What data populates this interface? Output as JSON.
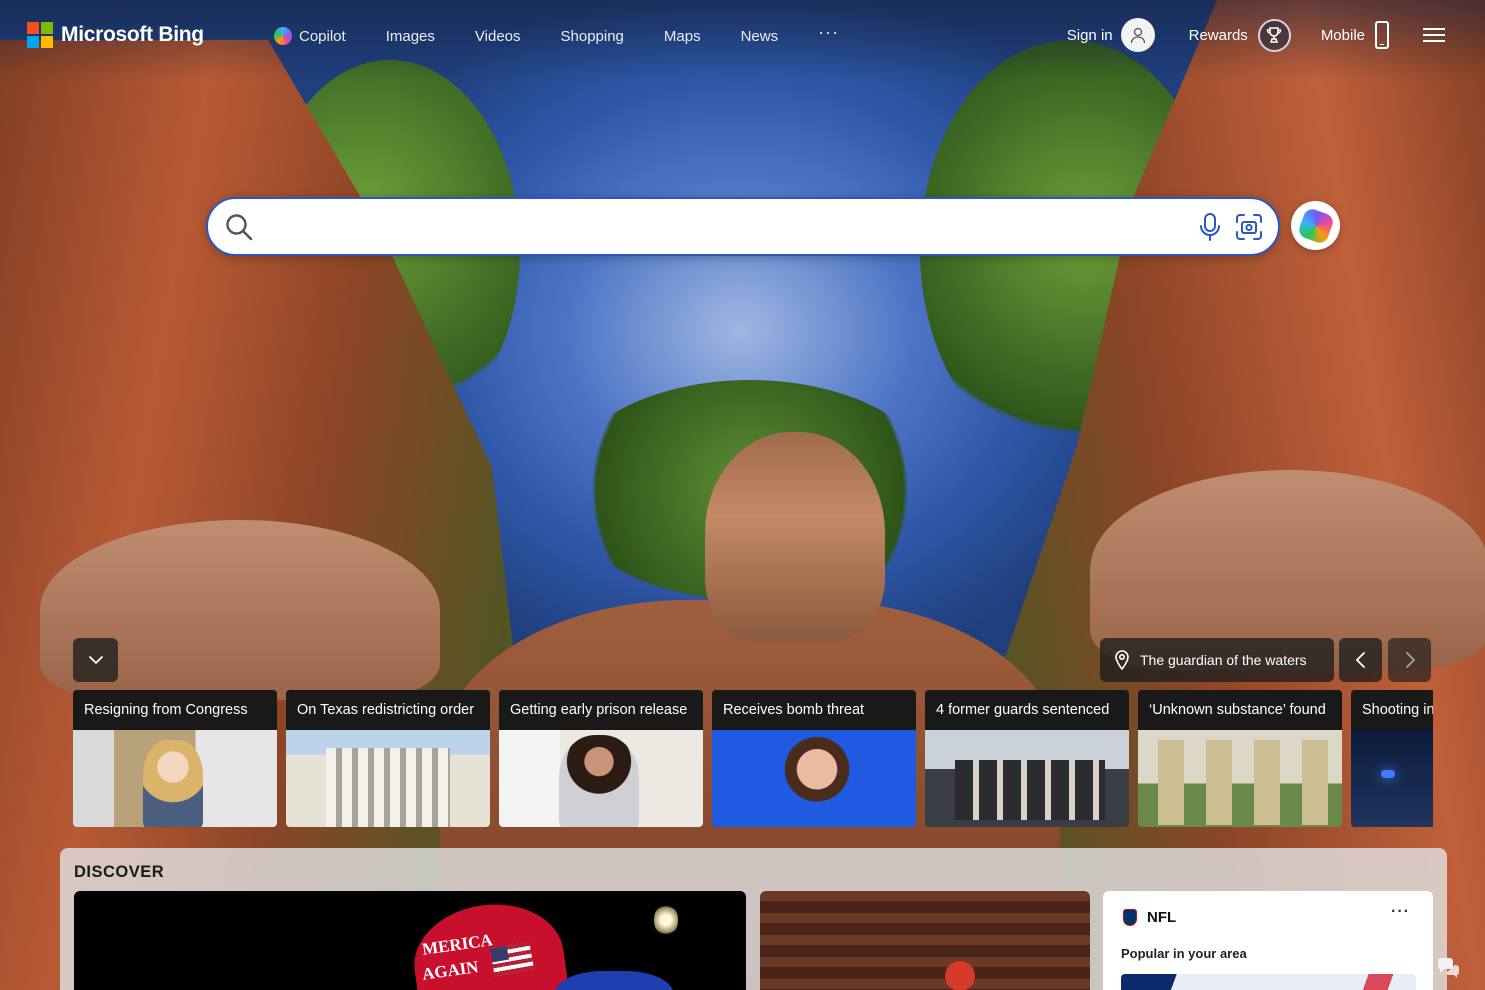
{
  "brand": {
    "name": "Microsoft Bing",
    "logo_colors": [
      "#f25022",
      "#7fba00",
      "#00a4ef",
      "#ffb900"
    ]
  },
  "nav": {
    "items": [
      {
        "label": "Copilot",
        "icon": "copilot-icon"
      },
      {
        "label": "Images"
      },
      {
        "label": "Videos"
      },
      {
        "label": "Shopping"
      },
      {
        "label": "Maps"
      },
      {
        "label": "News"
      }
    ],
    "more": "···"
  },
  "header": {
    "sign_in": "Sign in",
    "rewards": "Rewards",
    "mobile": "Mobile"
  },
  "search": {
    "value": "",
    "placeholder": "",
    "accent_color": "#2a56c6"
  },
  "image_info": {
    "title": "The guardian of the waters"
  },
  "news": [
    {
      "title": "Resigning from Congress"
    },
    {
      "title": "On Texas redistricting order"
    },
    {
      "title": "Getting early prison release"
    },
    {
      "title": "Receives bomb threat"
    },
    {
      "title": "4 former guards sentenced"
    },
    {
      "title": "‘Unknown substance’ found"
    },
    {
      "title": "Shooting in"
    }
  ],
  "discover": {
    "title": "DISCOVER",
    "feature_hat_line1": "MERICA",
    "feature_hat_line2": "AGAIN",
    "widget": {
      "league": "NFL",
      "more": "···",
      "subtitle": "Popular in your area"
    }
  }
}
